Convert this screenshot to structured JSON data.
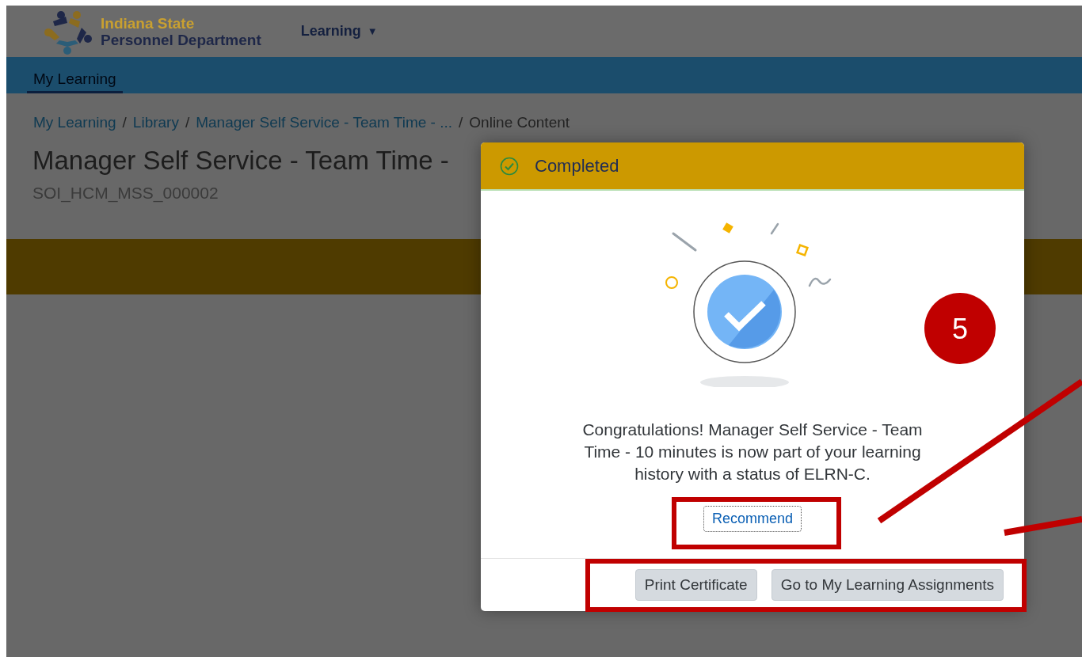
{
  "header": {
    "logo_line_1": "Indiana State",
    "logo_line_2": "Personnel Department",
    "menu": {
      "label": "Learning",
      "caret": "▼"
    }
  },
  "nav_tabs": [
    {
      "label": "My Learning",
      "selected": true
    }
  ],
  "breadcrumb": [
    {
      "label": "My Learning",
      "kind": "link"
    },
    {
      "separator": "/",
      "label": "Library",
      "kind": "link"
    },
    {
      "separator": "/",
      "label": "Manager Self Service - Team Time - ...",
      "kind": "link"
    },
    {
      "separator": "/",
      "label": "Online Content",
      "kind": "current"
    }
  ],
  "page_title": "Manager Self Service - Team Time -",
  "item_id": "SOI_HCM_MSS_000002",
  "dialog": {
    "status": "Completed",
    "message": "Congratulations! Manager Self Service - Team Time - 10 minutes is now part of your learning history with a status of ELRN-C.",
    "recommend_button": "Recommend",
    "buttons": [
      "Print Certificate",
      "Go to My Learning Assignments"
    ]
  },
  "annotation": {
    "step": "5"
  }
}
